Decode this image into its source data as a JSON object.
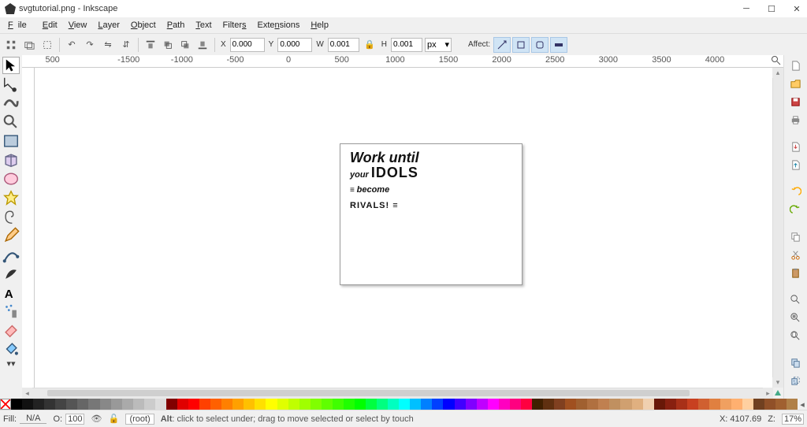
{
  "window": {
    "title": "svgtutorial.png - Inkscape"
  },
  "menu": {
    "file": "File",
    "edit": "Edit",
    "view": "View",
    "layer": "Layer",
    "object": "Object",
    "path": "Path",
    "text": "Text",
    "filters": "Filters",
    "extensions": "Extensions",
    "help": "Help"
  },
  "options": {
    "x_label": "X",
    "x": "0.000",
    "y_label": "Y",
    "y": "0.000",
    "w_label": "W",
    "w": "0.001",
    "h_label": "H",
    "h": "0.001",
    "lock": "🔒",
    "unit": "px",
    "affect_label": "Affect:"
  },
  "ruler": {
    "ticks": [
      "500",
      "",
      "-1500",
      "-1000",
      "-500",
      "0",
      "500",
      "1000",
      "1500",
      "2000",
      "2500",
      "3000",
      "3500",
      "4000"
    ]
  },
  "canvas_art": {
    "l1": "Work until",
    "l2a": "your ",
    "l2b": "IDOLS",
    "l3": "become",
    "l4": "RIVALS!"
  },
  "palette_colors": [
    "#000",
    "#111",
    "#222",
    "#333",
    "#444",
    "#555",
    "#666",
    "#777",
    "#888",
    "#999",
    "#aaa",
    "#bbb",
    "#ccc",
    "#ddd",
    "#800000",
    "#e00000",
    "#ff0000",
    "#ff4000",
    "#ff6000",
    "#ff8000",
    "#ffa000",
    "#ffc000",
    "#ffe000",
    "#ffff00",
    "#e0ff00",
    "#c0ff00",
    "#a0ff00",
    "#80ff00",
    "#60ff00",
    "#40ff00",
    "#20ff00",
    "#00ff00",
    "#00ff40",
    "#00ff80",
    "#00ffc0",
    "#00ffff",
    "#00c0ff",
    "#0080ff",
    "#0040ff",
    "#0000ff",
    "#4000ff",
    "#8000ff",
    "#c000ff",
    "#ff00ff",
    "#ff00c0",
    "#ff0080",
    "#ff0040",
    "#402000",
    "#603010",
    "#804020",
    "#a05020",
    "#a06030",
    "#b07040",
    "#c08050",
    "#c09060",
    "#d0a070",
    "#e0b080",
    "#f0d0b0",
    "#681808",
    "#882010",
    "#a83018",
    "#c84020",
    "#d06030",
    "#e08040",
    "#f0a060",
    "#ffb070",
    "#ffd0a0",
    "#704020",
    "#905028",
    "#a06030",
    "#b08048"
  ],
  "status": {
    "fill_label": "Fill:",
    "na": "N/A",
    "opacity_label": "O:",
    "opacity": "100",
    "layer": "(root)",
    "hint": "Alt: click to select under; drag to move selected or select by touch",
    "x_readout": "X: 4107.69",
    "z_label": "Z:",
    "zoom": "17%"
  }
}
